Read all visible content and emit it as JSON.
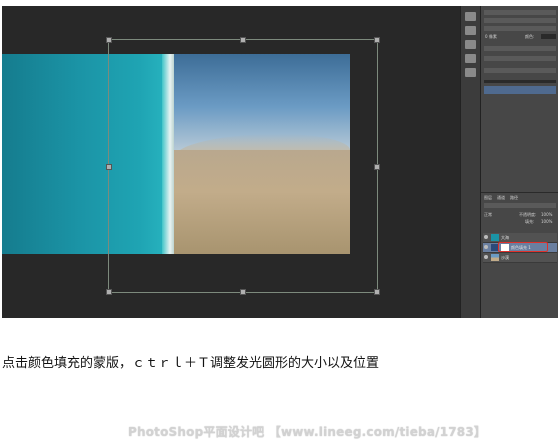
{
  "caption": "点击颜色填充的蒙版，ｃｔｒｌ＋Ｔ调整发光圆形的大小以及位置",
  "watermark": "PhotoShop平面设计吧 【www.lineeg.com/tieba/1783】",
  "layers_panel": {
    "tabs": [
      "图层",
      "通道",
      "路径"
    ],
    "blend_mode": "正常",
    "opacity_label": "不透明度:",
    "opacity_value": "100%",
    "fill_label": "填充:",
    "fill_value": "100%",
    "layers": [
      {
        "name": "大海",
        "selected": false
      },
      {
        "name": "颜色填充 1",
        "selected": true
      },
      {
        "name": "沙漠",
        "selected": false
      }
    ]
  },
  "char_panel": {
    "font_size": "0 像素",
    "color_label": "颜色:"
  },
  "colors": {
    "workspace": "#282828",
    "panel": "#474747",
    "highlight_box": "#e0302a"
  }
}
